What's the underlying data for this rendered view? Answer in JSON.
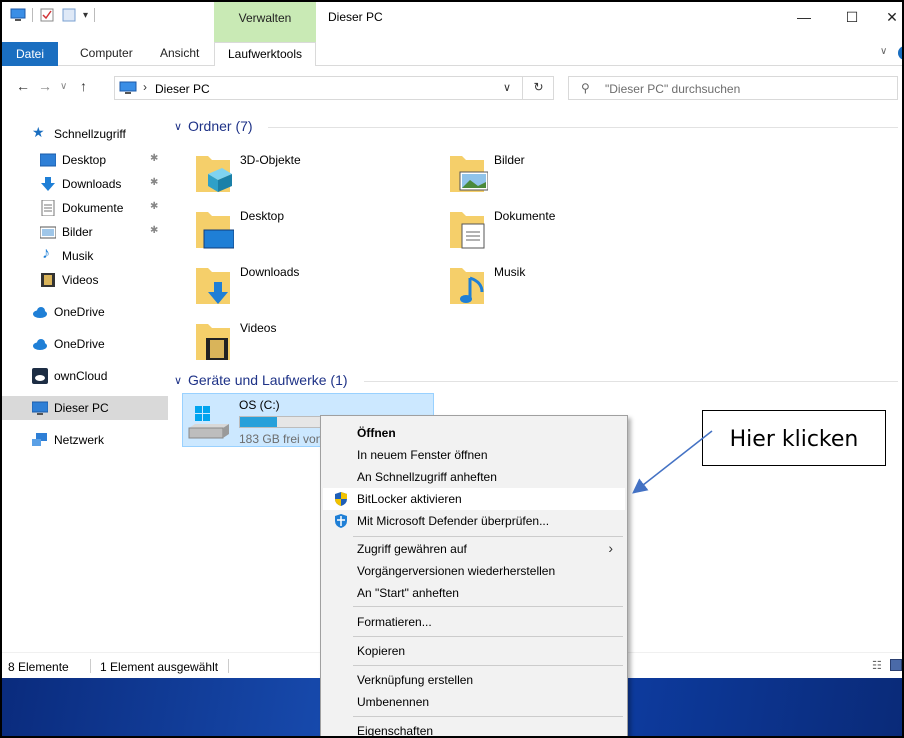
{
  "window": {
    "title": "Dieser PC",
    "context_tab_header": "Verwalten",
    "minimize": "—",
    "maximize": "☐",
    "close": "✕"
  },
  "ribbon": {
    "tabs": [
      "Datei",
      "Computer",
      "Ansicht",
      "Laufwerktools"
    ]
  },
  "address": {
    "path": "Dieser PC",
    "separator": "›",
    "search_placeholder": "\"Dieser PC\" durchsuchen"
  },
  "sidebar": {
    "items": [
      {
        "label": "Schnellzugriff",
        "icon": "star-icon"
      },
      {
        "label": "Desktop",
        "icon": "desktop-icon",
        "pinned": true
      },
      {
        "label": "Downloads",
        "icon": "download-icon",
        "pinned": true
      },
      {
        "label": "Dokumente",
        "icon": "document-icon",
        "pinned": true
      },
      {
        "label": "Bilder",
        "icon": "picture-icon",
        "pinned": true
      },
      {
        "label": "Musik",
        "icon": "music-icon"
      },
      {
        "label": "Videos",
        "icon": "video-icon"
      },
      {
        "label": "OneDrive",
        "icon": "cloud-icon"
      },
      {
        "label": "OneDrive",
        "icon": "cloud-icon"
      },
      {
        "label": "ownCloud",
        "icon": "owncloud-icon"
      },
      {
        "label": "Dieser PC",
        "icon": "computer-icon",
        "selected": true
      },
      {
        "label": "Netzwerk",
        "icon": "network-icon"
      }
    ]
  },
  "main": {
    "folders_header": "Ordner (7)",
    "folders": [
      "3D-Objekte",
      "Bilder",
      "Desktop",
      "Dokumente",
      "Downloads",
      "Musik",
      "Videos"
    ],
    "drives_header": "Geräte und Laufwerke (1)",
    "drive": {
      "name": "OS (C:)",
      "free_text": "183 GB frei von",
      "used_fraction": 0.2
    }
  },
  "status": {
    "count": "8 Elemente",
    "selected": "1 Element ausgewählt"
  },
  "context_menu": {
    "items": [
      {
        "label": "Öffnen",
        "bold": true
      },
      {
        "label": "In neuem Fenster öffnen"
      },
      {
        "label": "An Schnellzugriff anheften"
      },
      {
        "label": "BitLocker aktivieren",
        "icon": "shield-icon",
        "highlighted": true
      },
      {
        "label": "Mit Microsoft Defender überprüfen...",
        "icon": "defender-icon"
      },
      {
        "label": "Zugriff gewähren auf",
        "submenu": true
      },
      {
        "label": "Vorgängerversionen wiederherstellen"
      },
      {
        "label": "An \"Start\" anheften"
      },
      {
        "label": "Formatieren..."
      },
      {
        "label": "Kopieren"
      },
      {
        "label": "Verknüpfung erstellen"
      },
      {
        "label": "Umbenennen"
      },
      {
        "label": "Eigenschaften"
      }
    ]
  },
  "callout": {
    "text": "Hier klicken"
  },
  "colors": {
    "accent": "#1a6ec0",
    "context_tab": "#c9eab5",
    "selection": "#cce8ff",
    "drive_fill": "#26a0da",
    "header_blue": "#1e3287"
  }
}
